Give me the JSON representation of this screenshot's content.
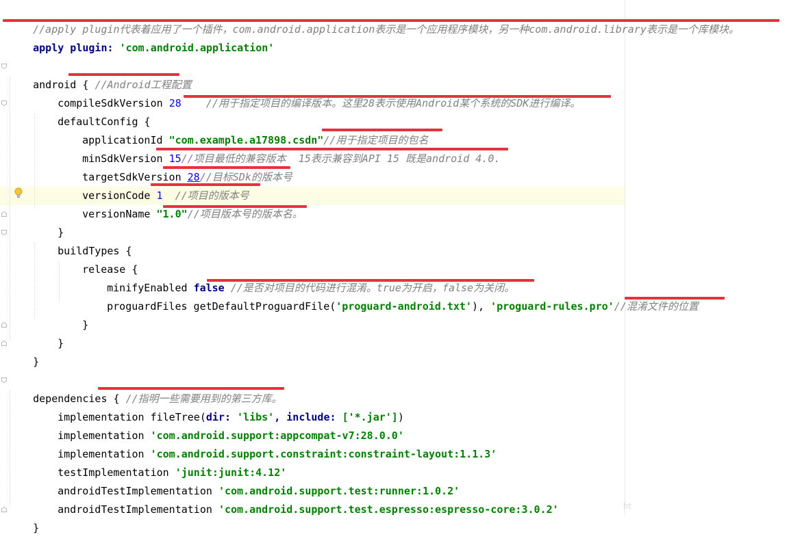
{
  "editor": {
    "lines": {
      "l1": {
        "comment": "//apply plugin代表着应用了一个插件，com.android.application表示是一个应用程序模块，另一种com.android.library表示是一个库模块。"
      },
      "l2": {
        "kw": "apply plugin:",
        "str": "'com.android.application'"
      },
      "l4": {
        "kw": "android {",
        "comment": "//Android工程配置"
      },
      "l5": {
        "key": "compileSdkVersion",
        "num": "28",
        "comment": "//用于指定项目的编译版本。这里28表示使用Android某个系统的SDK进行编译。"
      },
      "l6": {
        "key": "defaultConfig {"
      },
      "l7": {
        "key": "applicationId",
        "str": "\"com.example.a17898.csdn\"",
        "comment": "//用于指定项目的包名"
      },
      "l8": {
        "key": "minSdkVersion",
        "num": "15",
        "comment": "//项目最低的兼容版本  15表示兼容到API 15 既是android 4.0."
      },
      "l9": {
        "key": "targetSdkVersion",
        "num": "28",
        "comment": "//目标SDk的版本号"
      },
      "l10": {
        "key": "versionCode",
        "num": "1",
        "comment": "//项目的版本号"
      },
      "l11": {
        "key": "versionName",
        "str": "\"1.0\"",
        "comment": "//项目版本号的版本名。"
      },
      "l12": {
        "brace": "}"
      },
      "l13": {
        "key": "buildTypes {"
      },
      "l14": {
        "key": "release {"
      },
      "l15": {
        "key": "minifyEnabled",
        "kw": "false",
        "comment": "//是否对项目的代码进行混淆。true为开启，false为关闭。"
      },
      "l16": {
        "key": "proguardFiles getDefaultProguardFile(",
        "str1": "'proguard-android.txt'",
        "mid": "), ",
        "str2": "'proguard-rules.pro'",
        "comment": "//混淆文件的位置"
      },
      "l17": {
        "brace": "}"
      },
      "l18": {
        "brace": "}"
      },
      "l19": {
        "brace": "}"
      },
      "l21": {
        "kw": "dependencies {",
        "comment": "//指明一些需要用到的第三方库。"
      },
      "l22": {
        "key": "implementation fileTree(",
        "a1": "dir:",
        "s1": "'libs'",
        "a2": ", include:",
        "s2": "['*.jar']",
        "end": ")"
      },
      "l23": {
        "key": "implementation",
        "str": "'com.android.support:appcompat-v7:28.0.0'"
      },
      "l24": {
        "key": "implementation",
        "str": "'com.android.support.constraint:constraint-layout:1.1.3'"
      },
      "l25": {
        "key": "testImplementation",
        "str": "'junit:junit:4.12'"
      },
      "l26": {
        "key": "androidTestImplementation",
        "str": "'com.android.support.test:runner:1.0.2'"
      },
      "l27": {
        "key": "androidTestImplementation",
        "str": "'com.android.support.test.espresso:espresso-core:3.0.2'"
      },
      "l28": {
        "brace": "}"
      }
    },
    "watermark": "ht"
  },
  "colors": {
    "keyword": "#000080",
    "string": "#008000",
    "number": "#0000ff",
    "comment": "#808080",
    "annotation_underline": "#e5323e",
    "current_line": "#fdfce4"
  },
  "icons": {
    "gutter": "lightbulb-icon",
    "fold": "fold-marker-icon"
  }
}
